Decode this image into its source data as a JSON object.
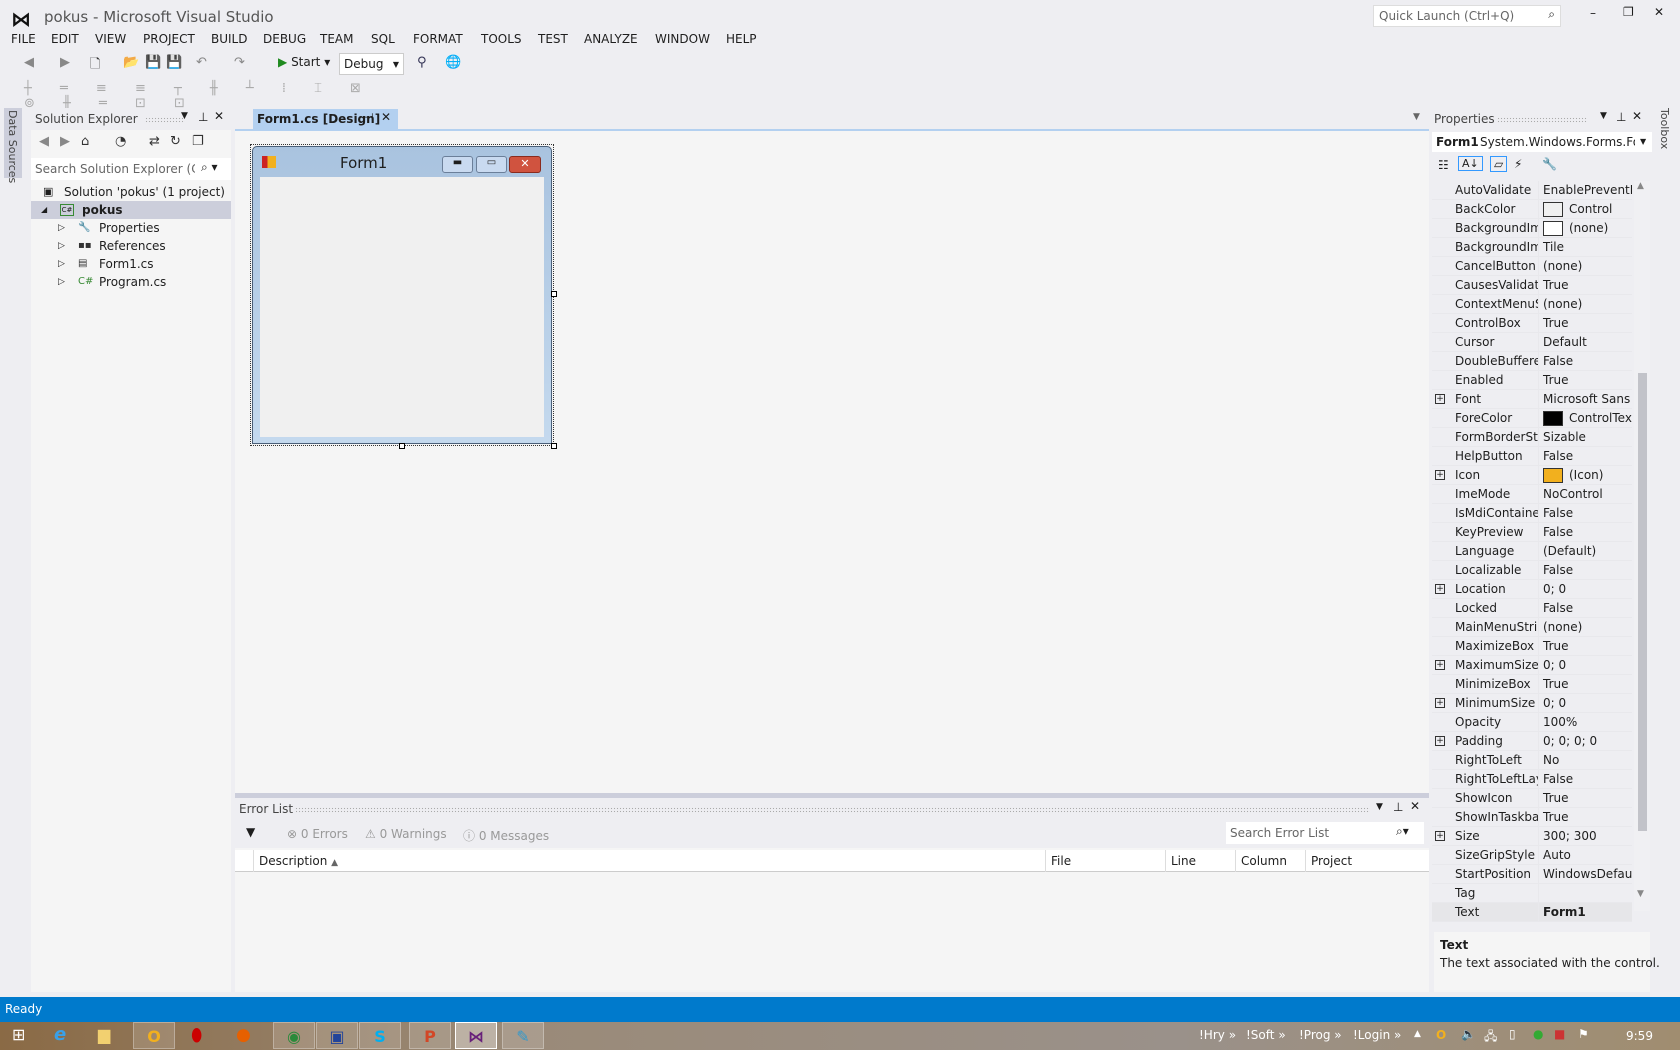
{
  "window": {
    "title": "pokus - Microsoft Visual Studio",
    "quick_launch_placeholder": "Quick Launch (Ctrl+Q)"
  },
  "menu": [
    "FILE",
    "EDIT",
    "VIEW",
    "PROJECT",
    "BUILD",
    "DEBUG",
    "TEAM",
    "SQL",
    "FORMAT",
    "TOOLS",
    "TEST",
    "ANALYZE",
    "WINDOW",
    "HELP"
  ],
  "toolbar": {
    "start_label": "Start",
    "config": "Debug"
  },
  "left_strip": {
    "label": "Data Sources"
  },
  "right_strip": {
    "label": "Toolbox"
  },
  "solution_explorer": {
    "title": "Solution Explorer",
    "search_placeholder": "Search Solution Explorer (Ctrl+",
    "solution": "Solution 'pokus' (1 project)",
    "project": "pokus",
    "items": [
      {
        "label": "Properties",
        "icon": "wrench-icon"
      },
      {
        "label": "References",
        "icon": "references-icon"
      },
      {
        "label": "Form1.cs",
        "icon": "form-icon"
      },
      {
        "label": "Program.cs",
        "icon": "csharp-icon"
      }
    ]
  },
  "document_tab": {
    "label": "Form1.cs [Design]"
  },
  "form": {
    "title": "Form1"
  },
  "error_list": {
    "title": "Error List",
    "errors": "0 Errors",
    "warnings": "0 Warnings",
    "messages": "0 Messages",
    "search_placeholder": "Search Error List",
    "columns": [
      "Description",
      "File",
      "Line",
      "Column",
      "Project"
    ]
  },
  "properties": {
    "title": "Properties",
    "object_name": "Form1",
    "object_type": "System.Windows.Forms.Form",
    "rows": [
      {
        "name": "AutoValidate",
        "value": "EnablePreventFocusChange"
      },
      {
        "name": "BackColor",
        "value": "Control",
        "swatch": "#f0f0f0"
      },
      {
        "name": "BackgroundImage",
        "value": "(none)",
        "swatch": "#ffffff"
      },
      {
        "name": "BackgroundImageLayout",
        "value": "Tile"
      },
      {
        "name": "CancelButton",
        "value": "(none)"
      },
      {
        "name": "CausesValidation",
        "value": "True"
      },
      {
        "name": "ContextMenuStrip",
        "value": "(none)"
      },
      {
        "name": "ControlBox",
        "value": "True"
      },
      {
        "name": "Cursor",
        "value": "Default"
      },
      {
        "name": "DoubleBuffered",
        "value": "False"
      },
      {
        "name": "Enabled",
        "value": "True"
      },
      {
        "name": "Font",
        "value": "Microsoft Sans Serif",
        "expandable": true
      },
      {
        "name": "ForeColor",
        "value": "ControlText",
        "swatch": "#000000"
      },
      {
        "name": "FormBorderStyle",
        "value": "Sizable"
      },
      {
        "name": "HelpButton",
        "value": "False"
      },
      {
        "name": "Icon",
        "value": "(Icon)",
        "expandable": true,
        "swatch": "#f2b01e"
      },
      {
        "name": "ImeMode",
        "value": "NoControl"
      },
      {
        "name": "IsMdiContainer",
        "value": "False"
      },
      {
        "name": "KeyPreview",
        "value": "False"
      },
      {
        "name": "Language",
        "value": "(Default)"
      },
      {
        "name": "Localizable",
        "value": "False"
      },
      {
        "name": "Location",
        "value": "0; 0",
        "expandable": true
      },
      {
        "name": "Locked",
        "value": "False"
      },
      {
        "name": "MainMenuStrip",
        "value": "(none)"
      },
      {
        "name": "MaximizeBox",
        "value": "True"
      },
      {
        "name": "MaximumSize",
        "value": "0; 0",
        "expandable": true
      },
      {
        "name": "MinimizeBox",
        "value": "True"
      },
      {
        "name": "MinimumSize",
        "value": "0; 0",
        "expandable": true
      },
      {
        "name": "Opacity",
        "value": "100%"
      },
      {
        "name": "Padding",
        "value": "0; 0; 0; 0",
        "expandable": true
      },
      {
        "name": "RightToLeft",
        "value": "No"
      },
      {
        "name": "RightToLeftLayout",
        "value": "False"
      },
      {
        "name": "ShowIcon",
        "value": "True"
      },
      {
        "name": "ShowInTaskbar",
        "value": "True"
      },
      {
        "name": "Size",
        "value": "300; 300",
        "expandable": true
      },
      {
        "name": "SizeGripStyle",
        "value": "Auto"
      },
      {
        "name": "StartPosition",
        "value": "WindowsDefaultLocation"
      },
      {
        "name": "Tag",
        "value": ""
      },
      {
        "name": "Text",
        "value": "Form1",
        "bold": true,
        "selected": true
      }
    ],
    "description_title": "Text",
    "description": "The text associated with the control."
  },
  "status": {
    "text": "Ready"
  },
  "taskbar": {
    "toolbars": [
      "!Hry",
      "!Soft",
      "!Prog",
      "!Login"
    ],
    "clock": "9:59"
  },
  "colors": {
    "accent": "#007acc",
    "status_bar": "#007acc",
    "tab_active": "#b3d0f0"
  }
}
